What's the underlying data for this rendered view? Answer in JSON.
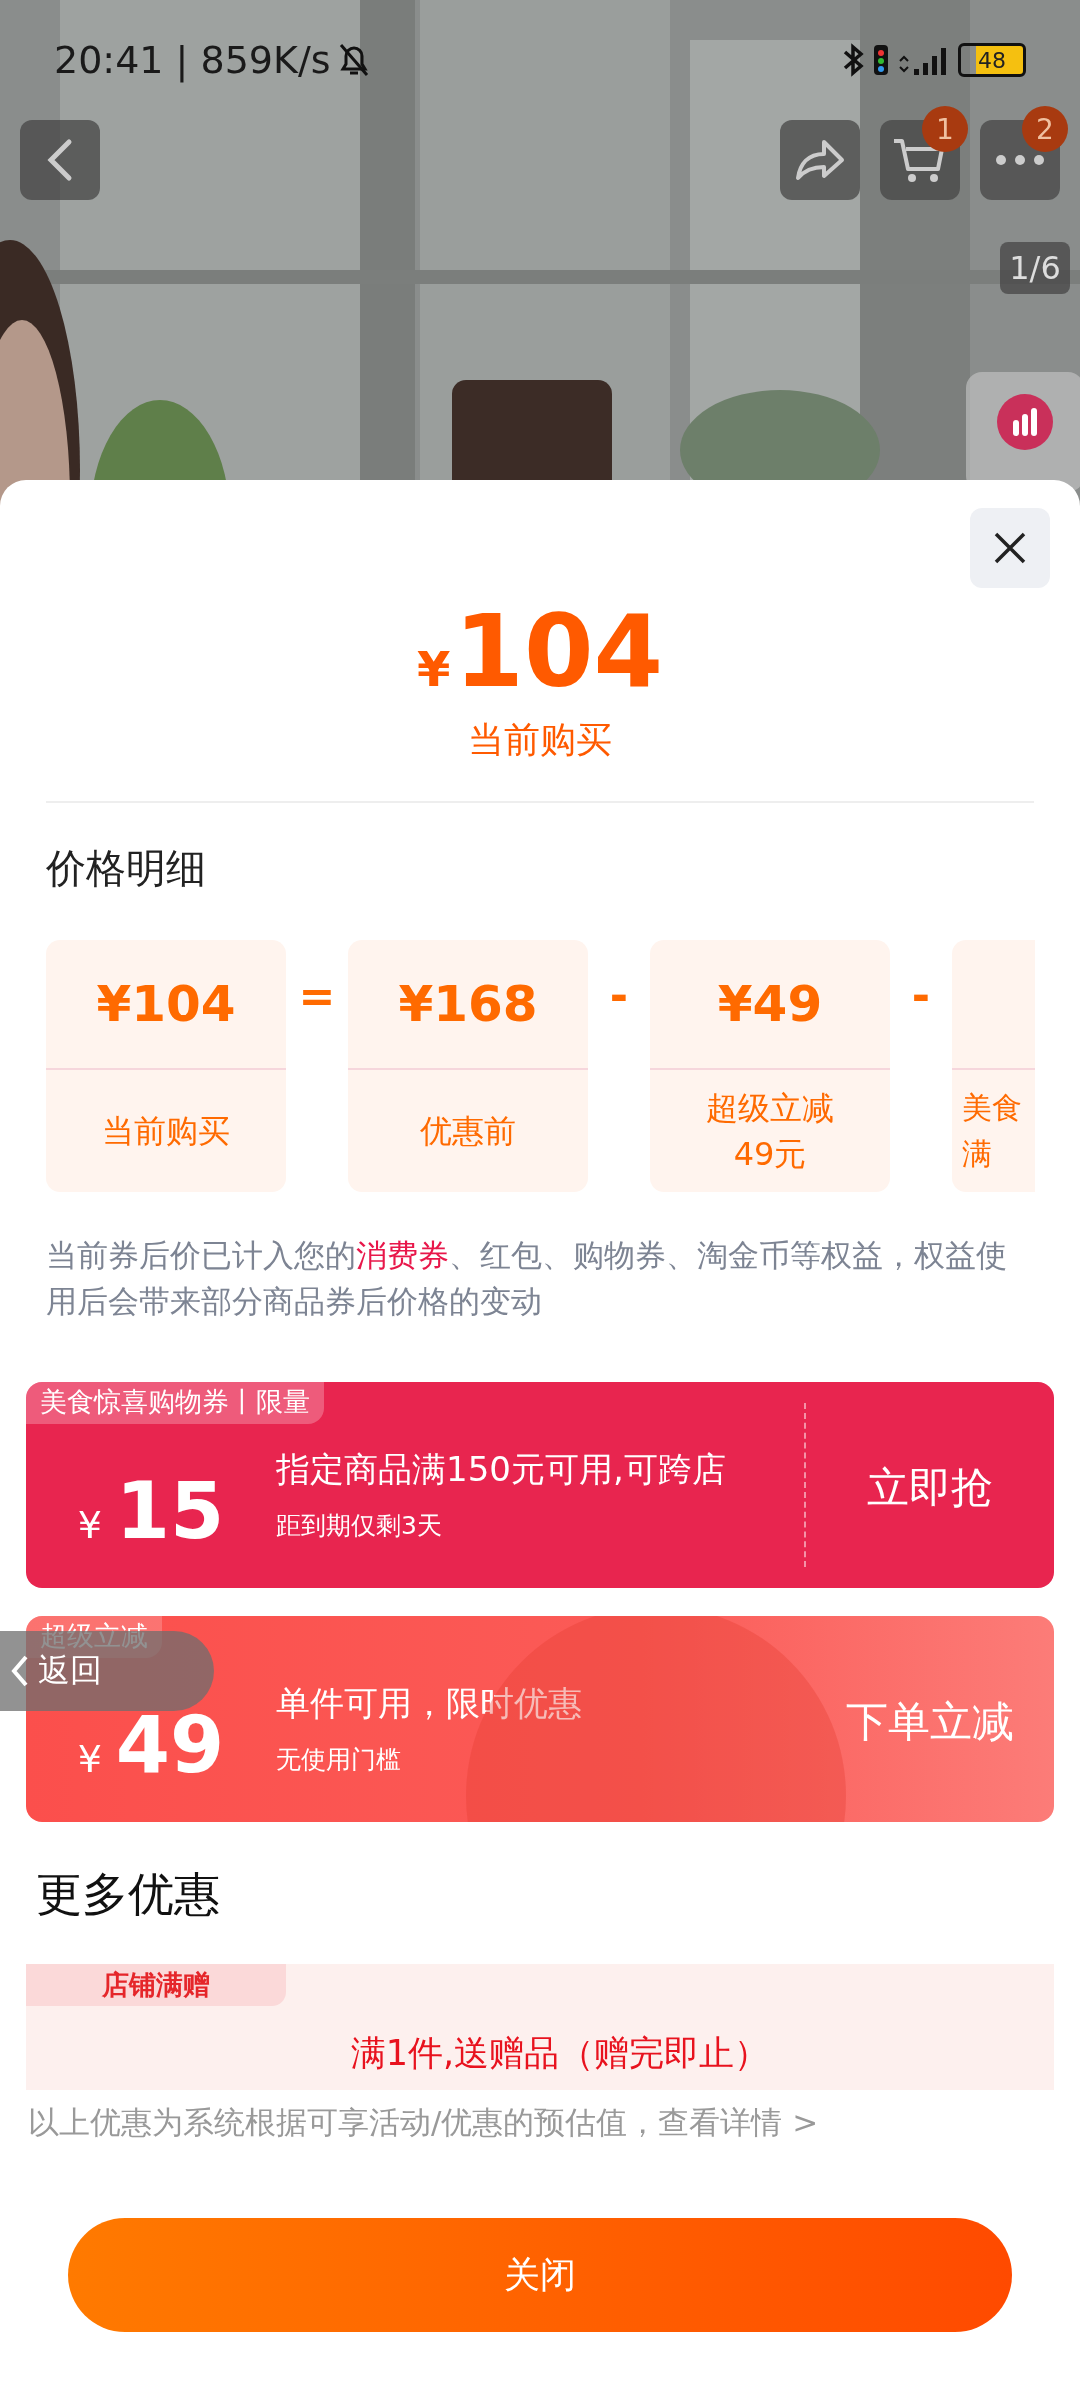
{
  "status_bar": {
    "time": "20:41 | 859K/s",
    "battery": "48"
  },
  "header": {
    "cart_badge": "1",
    "more_badge": "2",
    "image_counter": "1/6"
  },
  "summary": {
    "price_symbol": "¥",
    "price": "104",
    "label": "当前购买"
  },
  "breakdown": {
    "title": "价格明细",
    "cards": [
      {
        "price": "¥104",
        "label": [
          "当前购买"
        ]
      },
      {
        "operator": "=",
        "price": "¥168",
        "label": [
          "优惠前"
        ]
      },
      {
        "operator": "-",
        "price": "¥49",
        "label": [
          "超级立减",
          "49元"
        ]
      },
      {
        "operator": "-",
        "label": [
          "美食",
          "满"
        ]
      }
    ],
    "note": "当前券后价已计入您的**消费券**、红包、购物券、淘金币等权益，权益使用后会带来部分商品券后价格的变动"
  },
  "coupons": [
    {
      "kind": "coupon",
      "tag": "美食惊喜购物券丨限量",
      "symbol": "¥",
      "amount": "15",
      "title": "指定商品满150元可用,可跨店",
      "subtitle": "距到期仅剩3天",
      "action": "立即抢"
    },
    {
      "kind": "instant",
      "tag": "超级立减",
      "symbol": "¥",
      "amount": "49",
      "title": "单件可用，限时优惠",
      "subtitle": "无使用门槛",
      "action": "下单立减"
    }
  ],
  "float_back": {
    "label": "返回"
  },
  "more": {
    "title": "更多优惠",
    "gift_tag": "店铺满赠",
    "gift_text": "满1件,送赠品（赠完即止）",
    "footer": "以上优惠为系统根据可享活动/优惠的预估值，查看详情 >"
  },
  "close_button": "关闭"
}
